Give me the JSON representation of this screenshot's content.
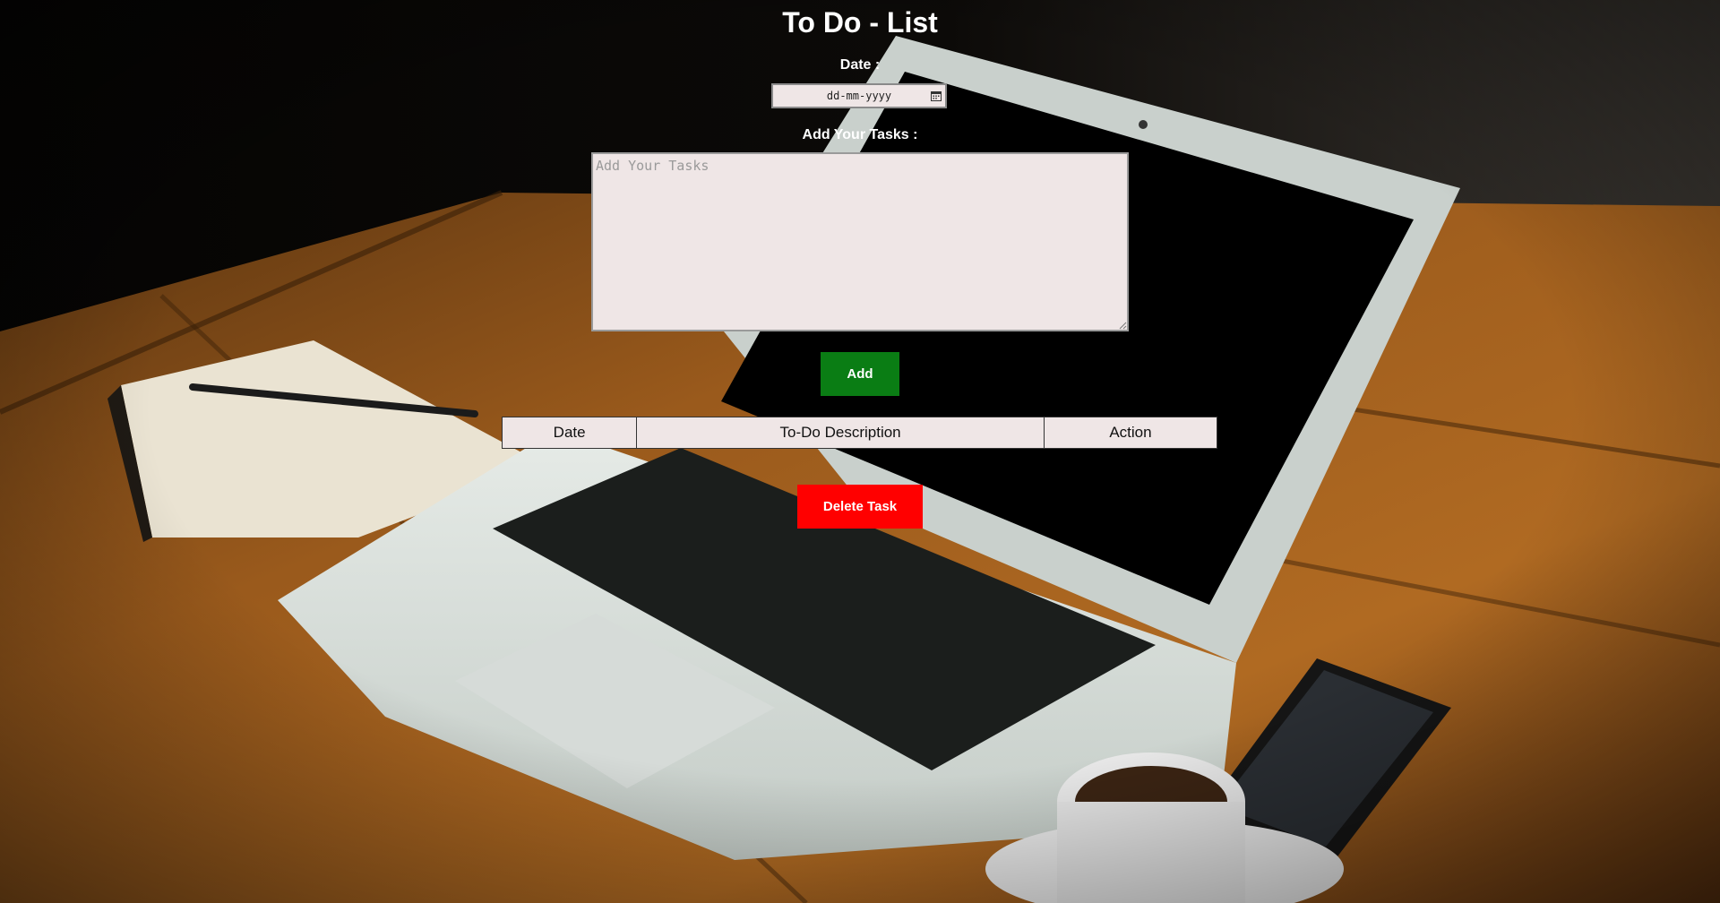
{
  "app": {
    "title": "To Do - List"
  },
  "form": {
    "date_label": "Date :",
    "date_placeholder": "dd-mm-yyyy",
    "tasks_label": "Add Your Tasks :",
    "tasks_placeholder": "Add Your Tasks",
    "tasks_value": "",
    "add_button": "Add"
  },
  "table": {
    "headers": [
      "Date",
      "To-Do Description",
      "Action"
    ],
    "rows": []
  },
  "actions": {
    "delete_button": "Delete Task"
  },
  "colors": {
    "add_button_bg": "#0a7d14",
    "delete_button_bg": "#ff0000",
    "input_bg": "#efe6e6",
    "title_text": "#ffffff"
  },
  "background": {
    "description_icon": "desk-laptop-photo"
  }
}
